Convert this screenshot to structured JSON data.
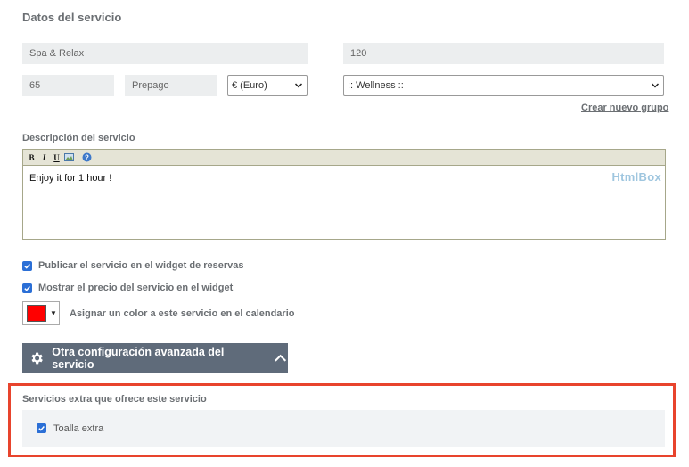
{
  "section": {
    "title": "Datos del servicio"
  },
  "fields": {
    "service_name": "Spa & Relax",
    "duration": "120",
    "price": "65",
    "payment_type": "Prepago",
    "currency": "€ (Euro)",
    "group": ":: Wellness ::"
  },
  "links": {
    "new_group": "Crear nuevo grupo"
  },
  "description": {
    "label": "Descripción del servicio",
    "toolbar": {
      "bold": "B",
      "italic": "I",
      "underline": "U"
    },
    "content": "Enjoy it for 1 hour !",
    "logo_text": "HtmlBox"
  },
  "options": {
    "publish_widget": {
      "label": "Publicar el servicio en el widget de reservas",
      "checked": true
    },
    "show_price": {
      "label": "Mostrar el precio del servicio en el widget",
      "checked": true
    },
    "color": {
      "label": "Asignar un color a este servicio en el calendario",
      "value": "#ff0000"
    }
  },
  "advanced": {
    "label": "Otra configuración avanzada del servicio"
  },
  "extras": {
    "title": "Servicios extra que ofrece este servicio",
    "items": [
      {
        "label": "Toalla extra",
        "checked": true
      }
    ]
  },
  "colors": {
    "accent": "#2b6fd6",
    "highlight_border": "#e8442d",
    "advanced_button": "#5f6b7a"
  }
}
